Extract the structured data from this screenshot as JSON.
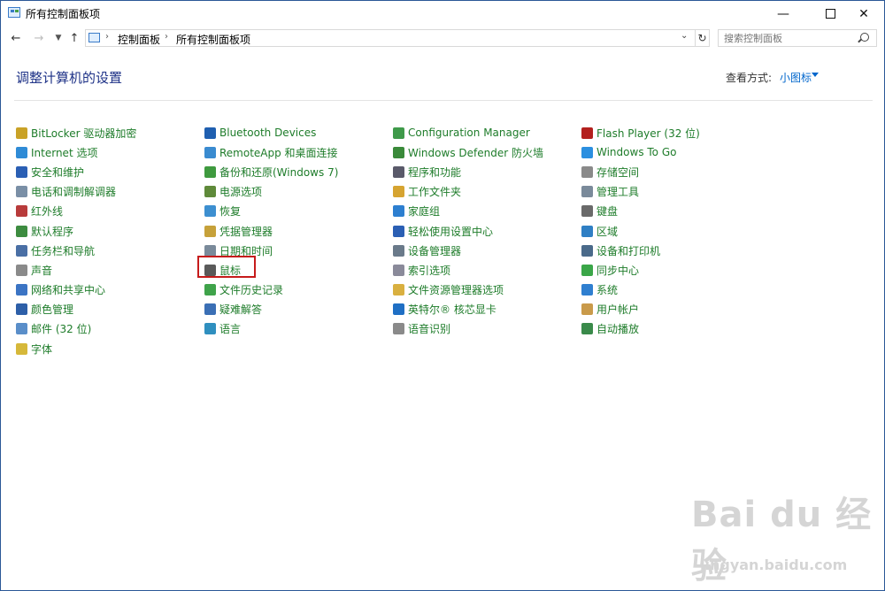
{
  "window": {
    "title": "所有控制面板项"
  },
  "address": {
    "crumbs": [
      "控制面板",
      "所有控制面板项"
    ],
    "search_placeholder": "搜索控制面板"
  },
  "header": {
    "title": "调整计算机的设置",
    "view_label": "查看方式:",
    "view_value": "小图标"
  },
  "columns": [
    [
      {
        "label": "BitLocker 驱动器加密",
        "icon": "bitlocker-icon",
        "color": "#c9a227"
      },
      {
        "label": "Internet 选项",
        "icon": "internet-options-icon",
        "color": "#2f8bd6"
      },
      {
        "label": "安全和维护",
        "icon": "flag-icon",
        "color": "#2b5fb4"
      },
      {
        "label": "电话和调制解调器",
        "icon": "phone-modem-icon",
        "color": "#7a8fa6"
      },
      {
        "label": "红外线",
        "icon": "infrared-icon",
        "color": "#b83b3b"
      },
      {
        "label": "默认程序",
        "icon": "default-programs-icon",
        "color": "#3d8c40"
      },
      {
        "label": "任务栏和导航",
        "icon": "taskbar-icon",
        "color": "#4a6fa5"
      },
      {
        "label": "声音",
        "icon": "speaker-icon",
        "color": "#8a8a8a"
      },
      {
        "label": "网络和共享中心",
        "icon": "network-icon",
        "color": "#3b74c4"
      },
      {
        "label": "颜色管理",
        "icon": "color-management-icon",
        "color": "#2d5fa8"
      },
      {
        "label": "邮件 (32 位)",
        "icon": "mail-icon",
        "color": "#5a8ec9"
      },
      {
        "label": "字体",
        "icon": "font-icon",
        "color": "#d6b83a"
      }
    ],
    [
      {
        "label": "Bluetooth Devices",
        "icon": "bluetooth-icon",
        "color": "#1f5fb0"
      },
      {
        "label": "RemoteApp 和桌面连接",
        "icon": "remoteapp-icon",
        "color": "#3a8bd0"
      },
      {
        "label": "备份和还原(Windows 7)",
        "icon": "backup-icon",
        "color": "#3f9a3f"
      },
      {
        "label": "电源选项",
        "icon": "power-options-icon",
        "color": "#5f8a3a"
      },
      {
        "label": "恢复",
        "icon": "recovery-icon",
        "color": "#3d8fd0"
      },
      {
        "label": "凭据管理器",
        "icon": "credential-icon",
        "color": "#c6a13a"
      },
      {
        "label": "日期和时间",
        "icon": "clock-icon",
        "color": "#7a8a9a"
      },
      {
        "label": "鼠标",
        "icon": "mouse-icon",
        "color": "#5a5a5a"
      },
      {
        "label": "文件历史记录",
        "icon": "file-history-icon",
        "color": "#3fa34a"
      },
      {
        "label": "疑难解答",
        "icon": "troubleshoot-icon",
        "color": "#3b6fb5"
      },
      {
        "label": "语言",
        "icon": "language-icon",
        "color": "#2f8fbf"
      }
    ],
    [
      {
        "label": "Configuration Manager",
        "icon": "configuration-icon",
        "color": "#3f9a4a"
      },
      {
        "label": "Windows Defender 防火墙",
        "icon": "firewall-icon",
        "color": "#3a8a3a"
      },
      {
        "label": "程序和功能",
        "icon": "programs-icon",
        "color": "#5a5a6a"
      },
      {
        "label": "工作文件夹",
        "icon": "work-folders-icon",
        "color": "#d6a431"
      },
      {
        "label": "家庭组",
        "icon": "homegroup-icon",
        "color": "#2d7fd0"
      },
      {
        "label": "轻松使用设置中心",
        "icon": "ease-of-access-icon",
        "color": "#2b5fb4"
      },
      {
        "label": "设备管理器",
        "icon": "device-manager-icon",
        "color": "#6a7a8a"
      },
      {
        "label": "索引选项",
        "icon": "indexing-icon",
        "color": "#8a8a9a"
      },
      {
        "label": "文件资源管理器选项",
        "icon": "folder-options-icon",
        "color": "#d9b040"
      },
      {
        "label": "英特尔® 核芯显卡",
        "icon": "intel-graphics-icon",
        "color": "#1f6fc4"
      },
      {
        "label": "语音识别",
        "icon": "microphone-icon",
        "color": "#8a8a8a"
      }
    ],
    [
      {
        "label": "Flash Player (32 位)",
        "icon": "flash-player-icon",
        "color": "#b3201e"
      },
      {
        "label": "Windows To Go",
        "icon": "windows-to-go-icon",
        "color": "#2b8fe0"
      },
      {
        "label": "存储空间",
        "icon": "storage-spaces-icon",
        "color": "#8a8a8a"
      },
      {
        "label": "管理工具",
        "icon": "admin-tools-icon",
        "color": "#7a8a9a"
      },
      {
        "label": "键盘",
        "icon": "keyboard-icon",
        "color": "#6a6a6a"
      },
      {
        "label": "区域",
        "icon": "region-icon",
        "color": "#2f7fc4"
      },
      {
        "label": "设备和打印机",
        "icon": "printer-icon",
        "color": "#4a6a8a"
      },
      {
        "label": "同步中心",
        "icon": "sync-icon",
        "color": "#3aa648"
      },
      {
        "label": "系统",
        "icon": "system-icon",
        "color": "#2f7fd0"
      },
      {
        "label": "用户帐户",
        "icon": "user-accounts-icon",
        "color": "#c99a4a"
      },
      {
        "label": "自动播放",
        "icon": "autoplay-icon",
        "color": "#3a8a4a"
      }
    ]
  ],
  "watermark": {
    "text": "Bai du 经验",
    "url": "jingyan.baidu.com"
  }
}
